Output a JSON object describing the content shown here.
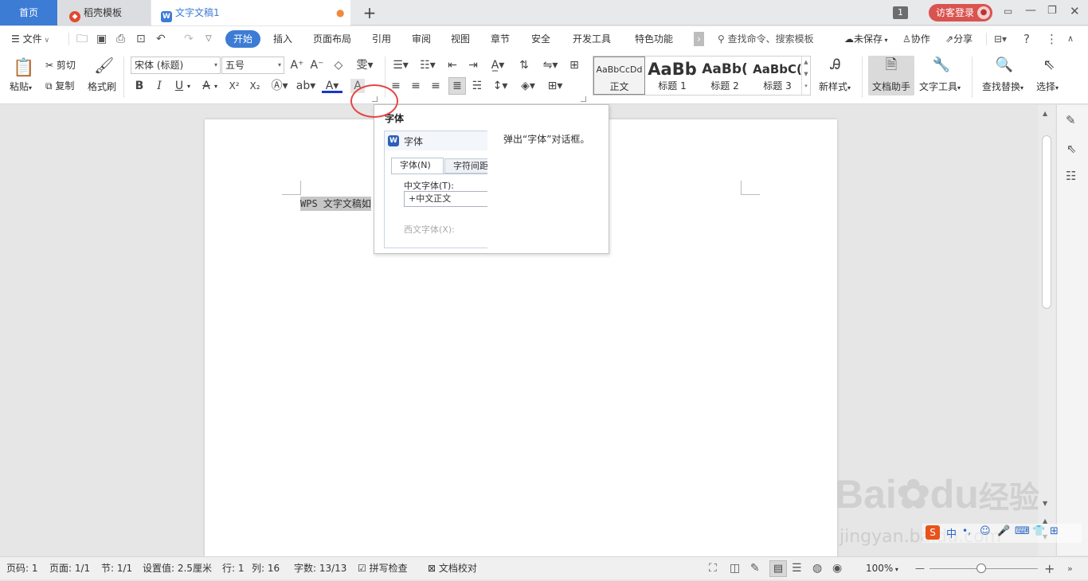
{
  "tabs": {
    "home": "首页",
    "daoke": "稻壳模板",
    "doc": "文字文稿1",
    "new": "+",
    "badge": "1",
    "login": "访客登录"
  },
  "menu": {
    "file": "文件",
    "items": [
      "开始",
      "插入",
      "页面布局",
      "引用",
      "审阅",
      "视图",
      "章节",
      "安全",
      "开发工具",
      "特色功能"
    ],
    "search": "查找命令、搜索模板",
    "unsaved": "未保存",
    "collab": "协作",
    "share": "分享",
    "help": "?",
    "more": "⋮",
    "expand": "›"
  },
  "ribbon": {
    "paste": "粘贴",
    "cut": "剪切",
    "copy": "复制",
    "format_painter": "格式刷",
    "font_name": "宋体 (标题)",
    "font_size": "五号",
    "bold": "B",
    "italic": "I",
    "underline": "U",
    "strike": "A",
    "sup": "X²",
    "sub": "X₂",
    "styles": [
      {
        "sample": "AaBbCcDd",
        "label": "正文"
      },
      {
        "sample": "AaBb",
        "label": "标题 1"
      },
      {
        "sample": "AaBb(",
        "label": "标题 2"
      },
      {
        "sample": "AaBbC(",
        "label": "标题 3"
      }
    ],
    "new_style": "新样式",
    "doc_helper": "文档助手",
    "text_tools": "文字工具",
    "find_replace": "查找替换",
    "select": "选择"
  },
  "popup": {
    "title": "字体",
    "desc": "弹出“字体”对话框。",
    "dlg_title": "字体",
    "tab_font": "字体(N)",
    "tab_spacing": "字符间距",
    "label_cn": "中文字体(T):",
    "value_cn": "+中文正文",
    "label_west": "西文字体(X):"
  },
  "doc": {
    "text": "WPS 文字文稿如"
  },
  "status": {
    "page_no": "页码: 1",
    "pages": "页面: 1/1",
    "section": "节: 1/1",
    "setting": "设置值: 2.5厘米",
    "row": "行: 1",
    "col": "列: 16",
    "words": "字数: 13/13",
    "spell": "拼写检查",
    "proof": "文档校对",
    "zoom": "100%",
    "zoom_minus": "—",
    "zoom_plus": "+"
  },
  "watermark": {
    "brand": "Bai",
    "brand2": "du",
    "jy": "经验",
    "url": "jingyan.baidu.com",
    "ime": "中"
  },
  "colors": {
    "accent": "#3d7cd5",
    "login": "#d9534f",
    "highlight": "#e54545"
  }
}
